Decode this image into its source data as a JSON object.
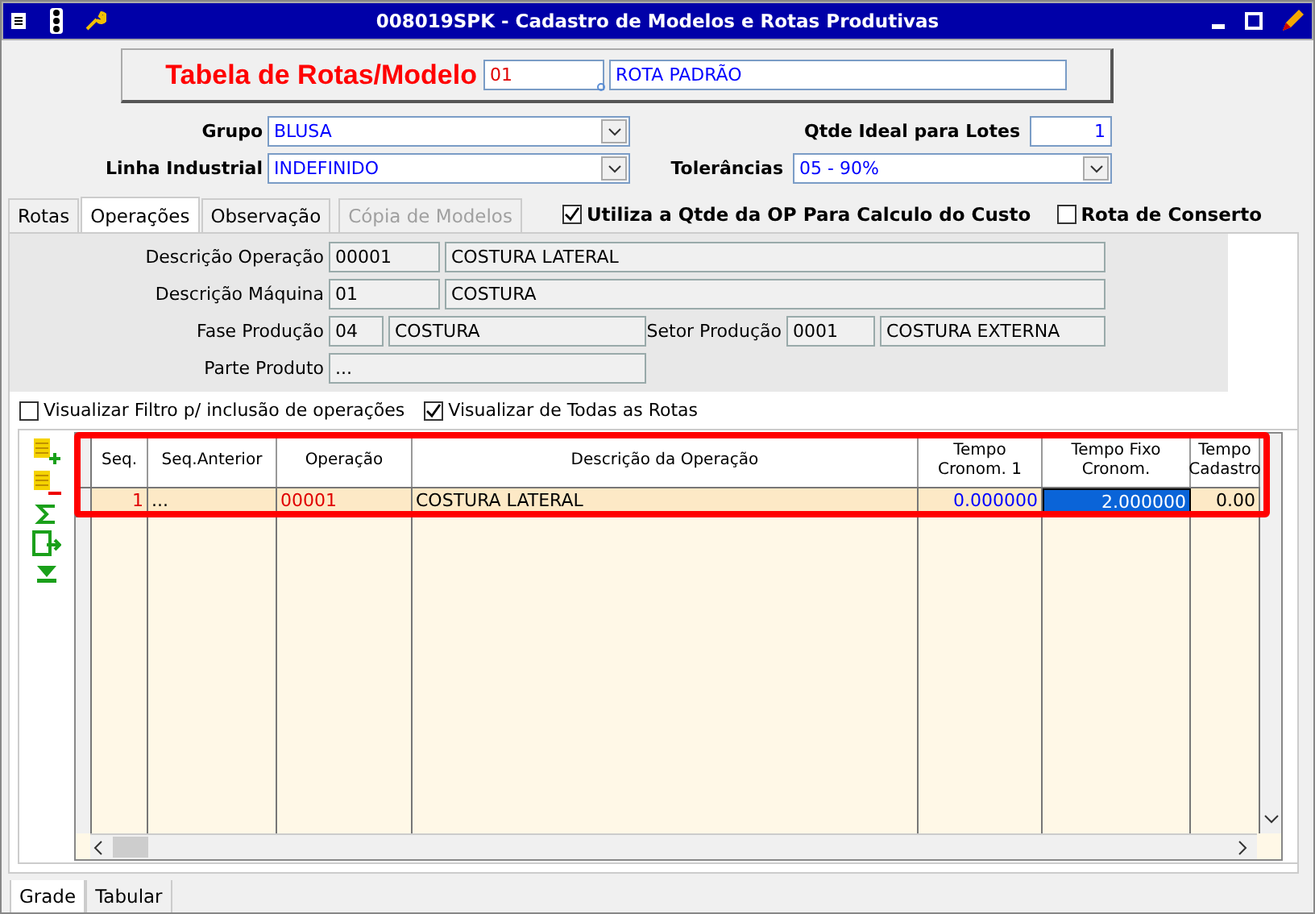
{
  "window": {
    "title": "008019SPK - Cadastro de Modelos e Rotas Produtivas"
  },
  "header": {
    "label": "Tabela de Rotas/Modelo",
    "code": "01",
    "name": "ROTA PADRÃO"
  },
  "grupo": {
    "label": "Grupo",
    "value": "BLUSA"
  },
  "linha": {
    "label": "Linha Industrial",
    "value": "INDEFINIDO"
  },
  "qtde": {
    "label": "Qtde Ideal para Lotes",
    "value": "1"
  },
  "tolerancias": {
    "label": "Tolerâncias",
    "value": "05 - 90%"
  },
  "tabs": [
    {
      "label": "Rotas",
      "selected": false,
      "disabled": false
    },
    {
      "label": "Operações",
      "selected": true,
      "disabled": false
    },
    {
      "label": "Observação",
      "selected": false,
      "disabled": false
    },
    {
      "label": "Cópia de Modelos",
      "selected": false,
      "disabled": true
    }
  ],
  "options": [
    {
      "label": "Utiliza a Qtde da OP Para Calculo do Custo",
      "checked": true
    },
    {
      "label": "Rota de Conserto",
      "checked": false
    }
  ],
  "details": {
    "descricao_operacao": {
      "label": "Descrição Operação",
      "code": "00001",
      "name": "COSTURA LATERAL"
    },
    "descricao_maquina": {
      "label": "Descrição Máquina",
      "code": "01",
      "name": "COSTURA"
    },
    "fase_producao": {
      "label": "Fase Produção",
      "code": "04",
      "name": "COSTURA"
    },
    "setor_producao": {
      "label": "Setor Produção",
      "code": "0001",
      "name": "COSTURA EXTERNA"
    },
    "parte_produto": {
      "label": "Parte Produto",
      "value": "..."
    }
  },
  "filters": [
    {
      "label": "Visualizar Filtro p/ inclusão de operações",
      "checked": false
    },
    {
      "label": "Visualizar de Todas as Rotas",
      "checked": true
    }
  ],
  "table": {
    "columns": [
      "Seq.",
      "Seq.Anterior",
      "Operação",
      "Descrição da Operação",
      "Tempo Cronom. 1",
      "Tempo Fixo Cronom.",
      "Tempo Cadastro"
    ],
    "rows": [
      {
        "cells": [
          {
            "text": "1",
            "selected": false
          },
          {
            "text": "...",
            "selected": false
          },
          {
            "text": "00001",
            "selected": false
          },
          {
            "text": "COSTURA LATERAL",
            "selected": false
          },
          {
            "text": "0.000000",
            "selected": false
          },
          {
            "text": "2.000000",
            "selected": true
          },
          {
            "text": "0.00",
            "selected": false
          }
        ]
      }
    ]
  },
  "bottom_tabs": [
    {
      "label": "Grade",
      "selected": true
    },
    {
      "label": "Tabular",
      "selected": false
    }
  ]
}
